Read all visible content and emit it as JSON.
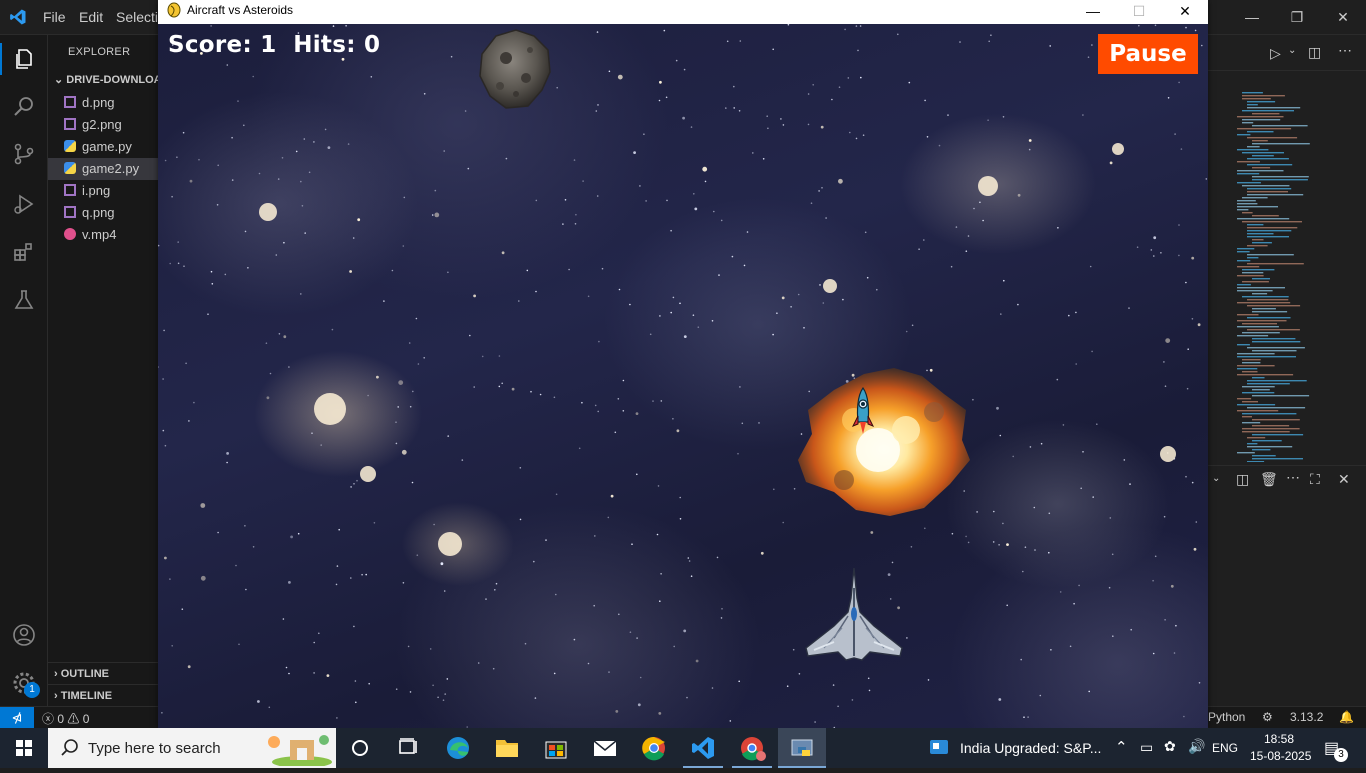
{
  "vscode": {
    "menu": [
      "File",
      "Edit",
      "Selectic"
    ],
    "explorer_title": "EXPLORER",
    "folder": "DRIVE-DOWNLOA",
    "files": [
      {
        "name": "d.png",
        "type": "image"
      },
      {
        "name": "g2.png",
        "type": "image"
      },
      {
        "name": "game.py",
        "type": "python"
      },
      {
        "name": "game2.py",
        "type": "python",
        "selected": true
      },
      {
        "name": "i.png",
        "type": "image"
      },
      {
        "name": "q.png",
        "type": "image"
      },
      {
        "name": "v.mp4",
        "type": "video"
      }
    ],
    "outline": "OUTLINE",
    "timeline": "TIMELINE",
    "settings_badge": "1",
    "status": {
      "problems": "0",
      "warnings": "0",
      "language": "Python",
      "version": "3.13.2"
    }
  },
  "game": {
    "window_title": "Aircraft vs Asteroids",
    "score_label": "Score:",
    "score": "1",
    "hits_label": "Hits:",
    "hits": "0",
    "pause_label": "Pause",
    "colors": {
      "pause_button": "#ff4b00",
      "hud_text": "#ffffff"
    }
  },
  "taskbar": {
    "search_placeholder": "Type here to search",
    "news": "India Upgraded: S&P...",
    "lang": "ENG",
    "time": "18:58",
    "date": "15-08-2025",
    "notifications": "3"
  }
}
